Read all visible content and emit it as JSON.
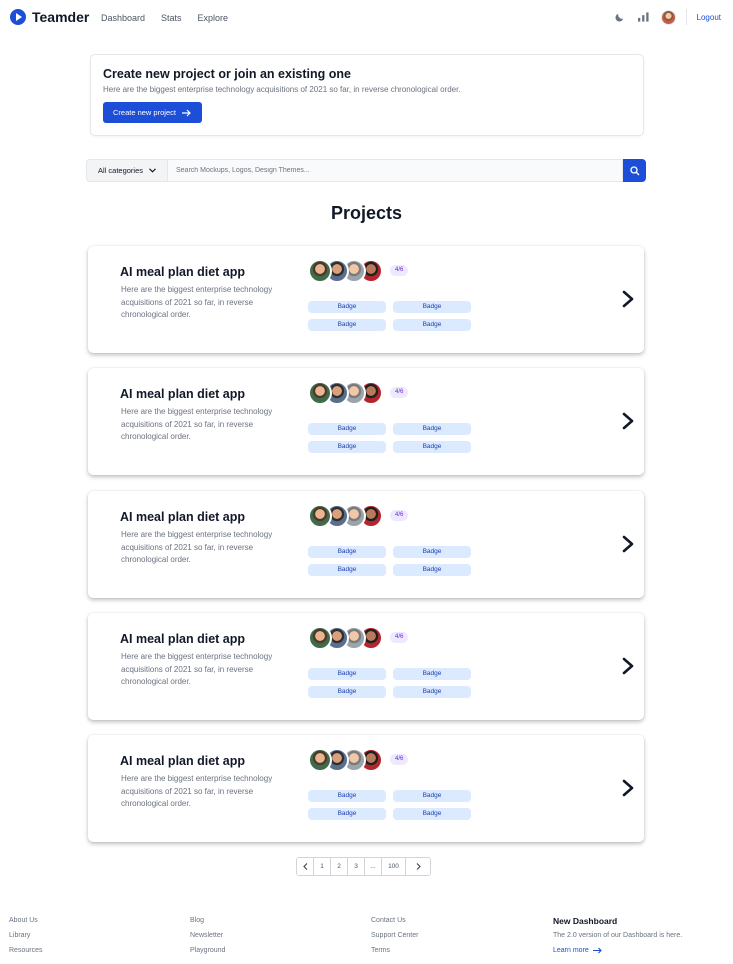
{
  "nav": {
    "brand": "Teamder",
    "links": [
      "Dashboard",
      "Stats",
      "Explore"
    ],
    "logout": "Logout"
  },
  "create": {
    "title": "Create new project or join an existing one",
    "subtitle": "Here are the biggest enterprise technology acquisitions of 2021 so far, in reverse chronological order.",
    "button": "Create new project"
  },
  "search": {
    "category": "All categories",
    "placeholder": "Search Mockups, Logos, Design Themes...",
    "value": ""
  },
  "projects": {
    "heading": "Projects",
    "items": [
      {
        "title": "AI meal plan diet app",
        "description": "Here are the biggest enterprise technology acquisitions of 2021 so far, in reverse chronological order.",
        "count": "4/6",
        "badges": [
          "Badge",
          "Badge",
          "Badge",
          "Badge"
        ]
      },
      {
        "title": "AI meal plan diet app",
        "description": "Here are the biggest enterprise technology acquisitions of 2021 so far, in reverse chronological order.",
        "count": "4/6",
        "badges": [
          "Badge",
          "Badge",
          "Badge",
          "Badge"
        ]
      },
      {
        "title": "AI meal plan diet app",
        "description": "Here are the biggest enterprise technology acquisitions of 2021 so far, in reverse chronological order.",
        "count": "4/6",
        "badges": [
          "Badge",
          "Badge",
          "Badge",
          "Badge"
        ]
      },
      {
        "title": "AI meal plan diet app",
        "description": "Here are the biggest enterprise technology acquisitions of 2021 so far, in reverse chronological order.",
        "count": "4/6",
        "badges": [
          "Badge",
          "Badge",
          "Badge",
          "Badge"
        ]
      },
      {
        "title": "AI meal plan diet app",
        "description": "Here are the biggest enterprise technology acquisitions of 2021 so far, in reverse chronological order.",
        "count": "4/6",
        "badges": [
          "Badge",
          "Badge",
          "Badge",
          "Badge"
        ]
      }
    ]
  },
  "pagination": {
    "prev_icon": "chevron-left-icon",
    "pages": [
      "1",
      "2",
      "3",
      "...",
      "100"
    ],
    "next_icon": "chevron-right-icon"
  },
  "footer": {
    "col1": [
      "About Us",
      "Library",
      "Resources"
    ],
    "col2": [
      "Blog",
      "Newsletter",
      "Playground"
    ],
    "col3": [
      "Contact Us",
      "Support Center",
      "Terms"
    ],
    "news": {
      "title": "New Dashboard",
      "subtitle": "The 2.0 version of our Dashboard is here.",
      "link": "Learn more"
    }
  },
  "colors": {
    "accent": "#1d4ed8",
    "badge_bg": "#dbeafe",
    "count_bg": "#ede9fe"
  }
}
